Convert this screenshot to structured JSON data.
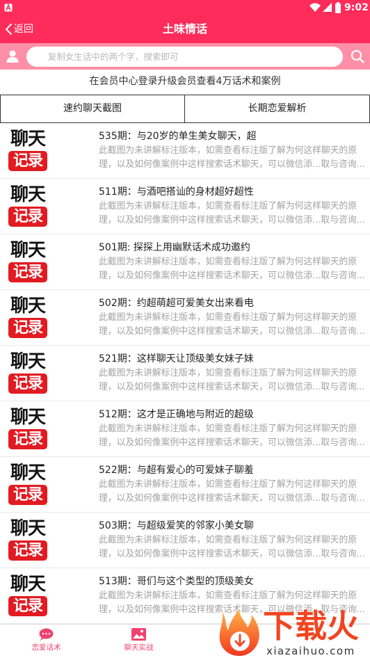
{
  "status_bar": {
    "time": "9:02",
    "icons": [
      "app-notification-icon",
      "wifi-icon",
      "signal-icon",
      "battery-icon"
    ]
  },
  "header": {
    "back_icon": "chevron-left-icon",
    "back_label": "返回",
    "title": "土味情话"
  },
  "search": {
    "left_icon": "user-icon",
    "placeholder": "复制女生话中的两个字，搜索即可",
    "right_icon": "search-icon"
  },
  "notice": "在会员中心登录升级会员查看4万话术和案例",
  "tabs": [
    {
      "label": "速约聊天截图"
    },
    {
      "label": "长期恋爱解析"
    }
  ],
  "thumbnail": {
    "top": "聊天",
    "bottom": "记录"
  },
  "items": [
    {
      "title": "535期：与20岁的单生美女聊天，超",
      "desc_lines": [
        "此截图为未讲解标注版本，如需查看标注版了解为何这样聊天的原",
        "理，以及如何像案例中这样搜索话术聊天，可以微信添...取与咨询....."
      ]
    },
    {
      "title": "511期：与酒吧搭讪的身材超好超性",
      "desc_lines": [
        "此截图为未讲解标注版本，如需查看标注版了解为何这样聊天的原",
        "理，以及如何像案例中这样搜索话术聊天，可以微信添...取与咨询....."
      ]
    },
    {
      "title": "501期: 探探上用幽默话术成功邀约",
      "desc_lines": [
        "此截图为未讲解标注版本，如需查看标注版了解为何这样聊天的原",
        "理，以及如何像案例中这样搜索话术聊天，可以微信添...取与咨询....."
      ]
    },
    {
      "title": "502期：约超萌超可爱美女出来看电",
      "desc_lines": [
        "此截图为未讲解标注版本，如需查看标注版了解为何这样聊天的原",
        "理，以及如何像案例中这样搜索话术聊天，可以微信添...取与咨询....."
      ]
    },
    {
      "title": "521期：这样聊天让顶级美女妹子妹",
      "desc_lines": [
        "此截图为未讲解标注版本，如需查看标注版了解为何这样聊天的原",
        "理，以及如何像案例中这样搜索话术聊天，可以微信添...取与咨询....."
      ]
    },
    {
      "title": "512期：这才是正确地与附近的超级",
      "desc_lines": [
        "此截图为未讲解标注版本，如需查看标注版了解为何这样聊天的原",
        "理，以及如何像案例中这样搜索话术聊天，可以微信添...取与咨询....."
      ]
    },
    {
      "title": "522期：与超有爱心的可爱妹子聊羞",
      "desc_lines": [
        "此截图为未讲解标注版本，如需查看标注版了解为何这样聊天的原",
        "理，以及如何像案例中这样搜索话术聊天，可以微信添...取与咨询....."
      ]
    },
    {
      "title": "503期：与超级爱笑的邻家小美女聊",
      "desc_lines": [
        "此截图为未讲解标注版本，如需查看标注版了解为何这样聊天的原",
        "理，以及如何像案例中这样搜索话术聊天，可以微信添...取与咨询....."
      ]
    },
    {
      "title": "513期：哥们与这个类型的顶级美女",
      "desc_lines": [
        "此截图为未讲解标注版本，如需查看标注版了解为何这样聊天的原",
        "理，以及如何像案例中这样搜索话术聊天，可以微信添...取与咨询....."
      ]
    }
  ],
  "bottom_nav": [
    {
      "label": "恋爱话术",
      "icon": "chat-bubble-icon"
    },
    {
      "label": "聊天实战",
      "icon": "picture-icon"
    }
  ],
  "watermark": {
    "icon": "flame-download-icon",
    "brand": "下载火",
    "url": "xiazaihuo.com"
  },
  "colors": {
    "primary": "#fe2c5a",
    "search_bar": "#ff8fa6",
    "thumbnail_red": "#e21b22",
    "nav_accent": "#f0426c",
    "description_text": "#a3a3a3",
    "watermark_red": "#f2441f"
  }
}
